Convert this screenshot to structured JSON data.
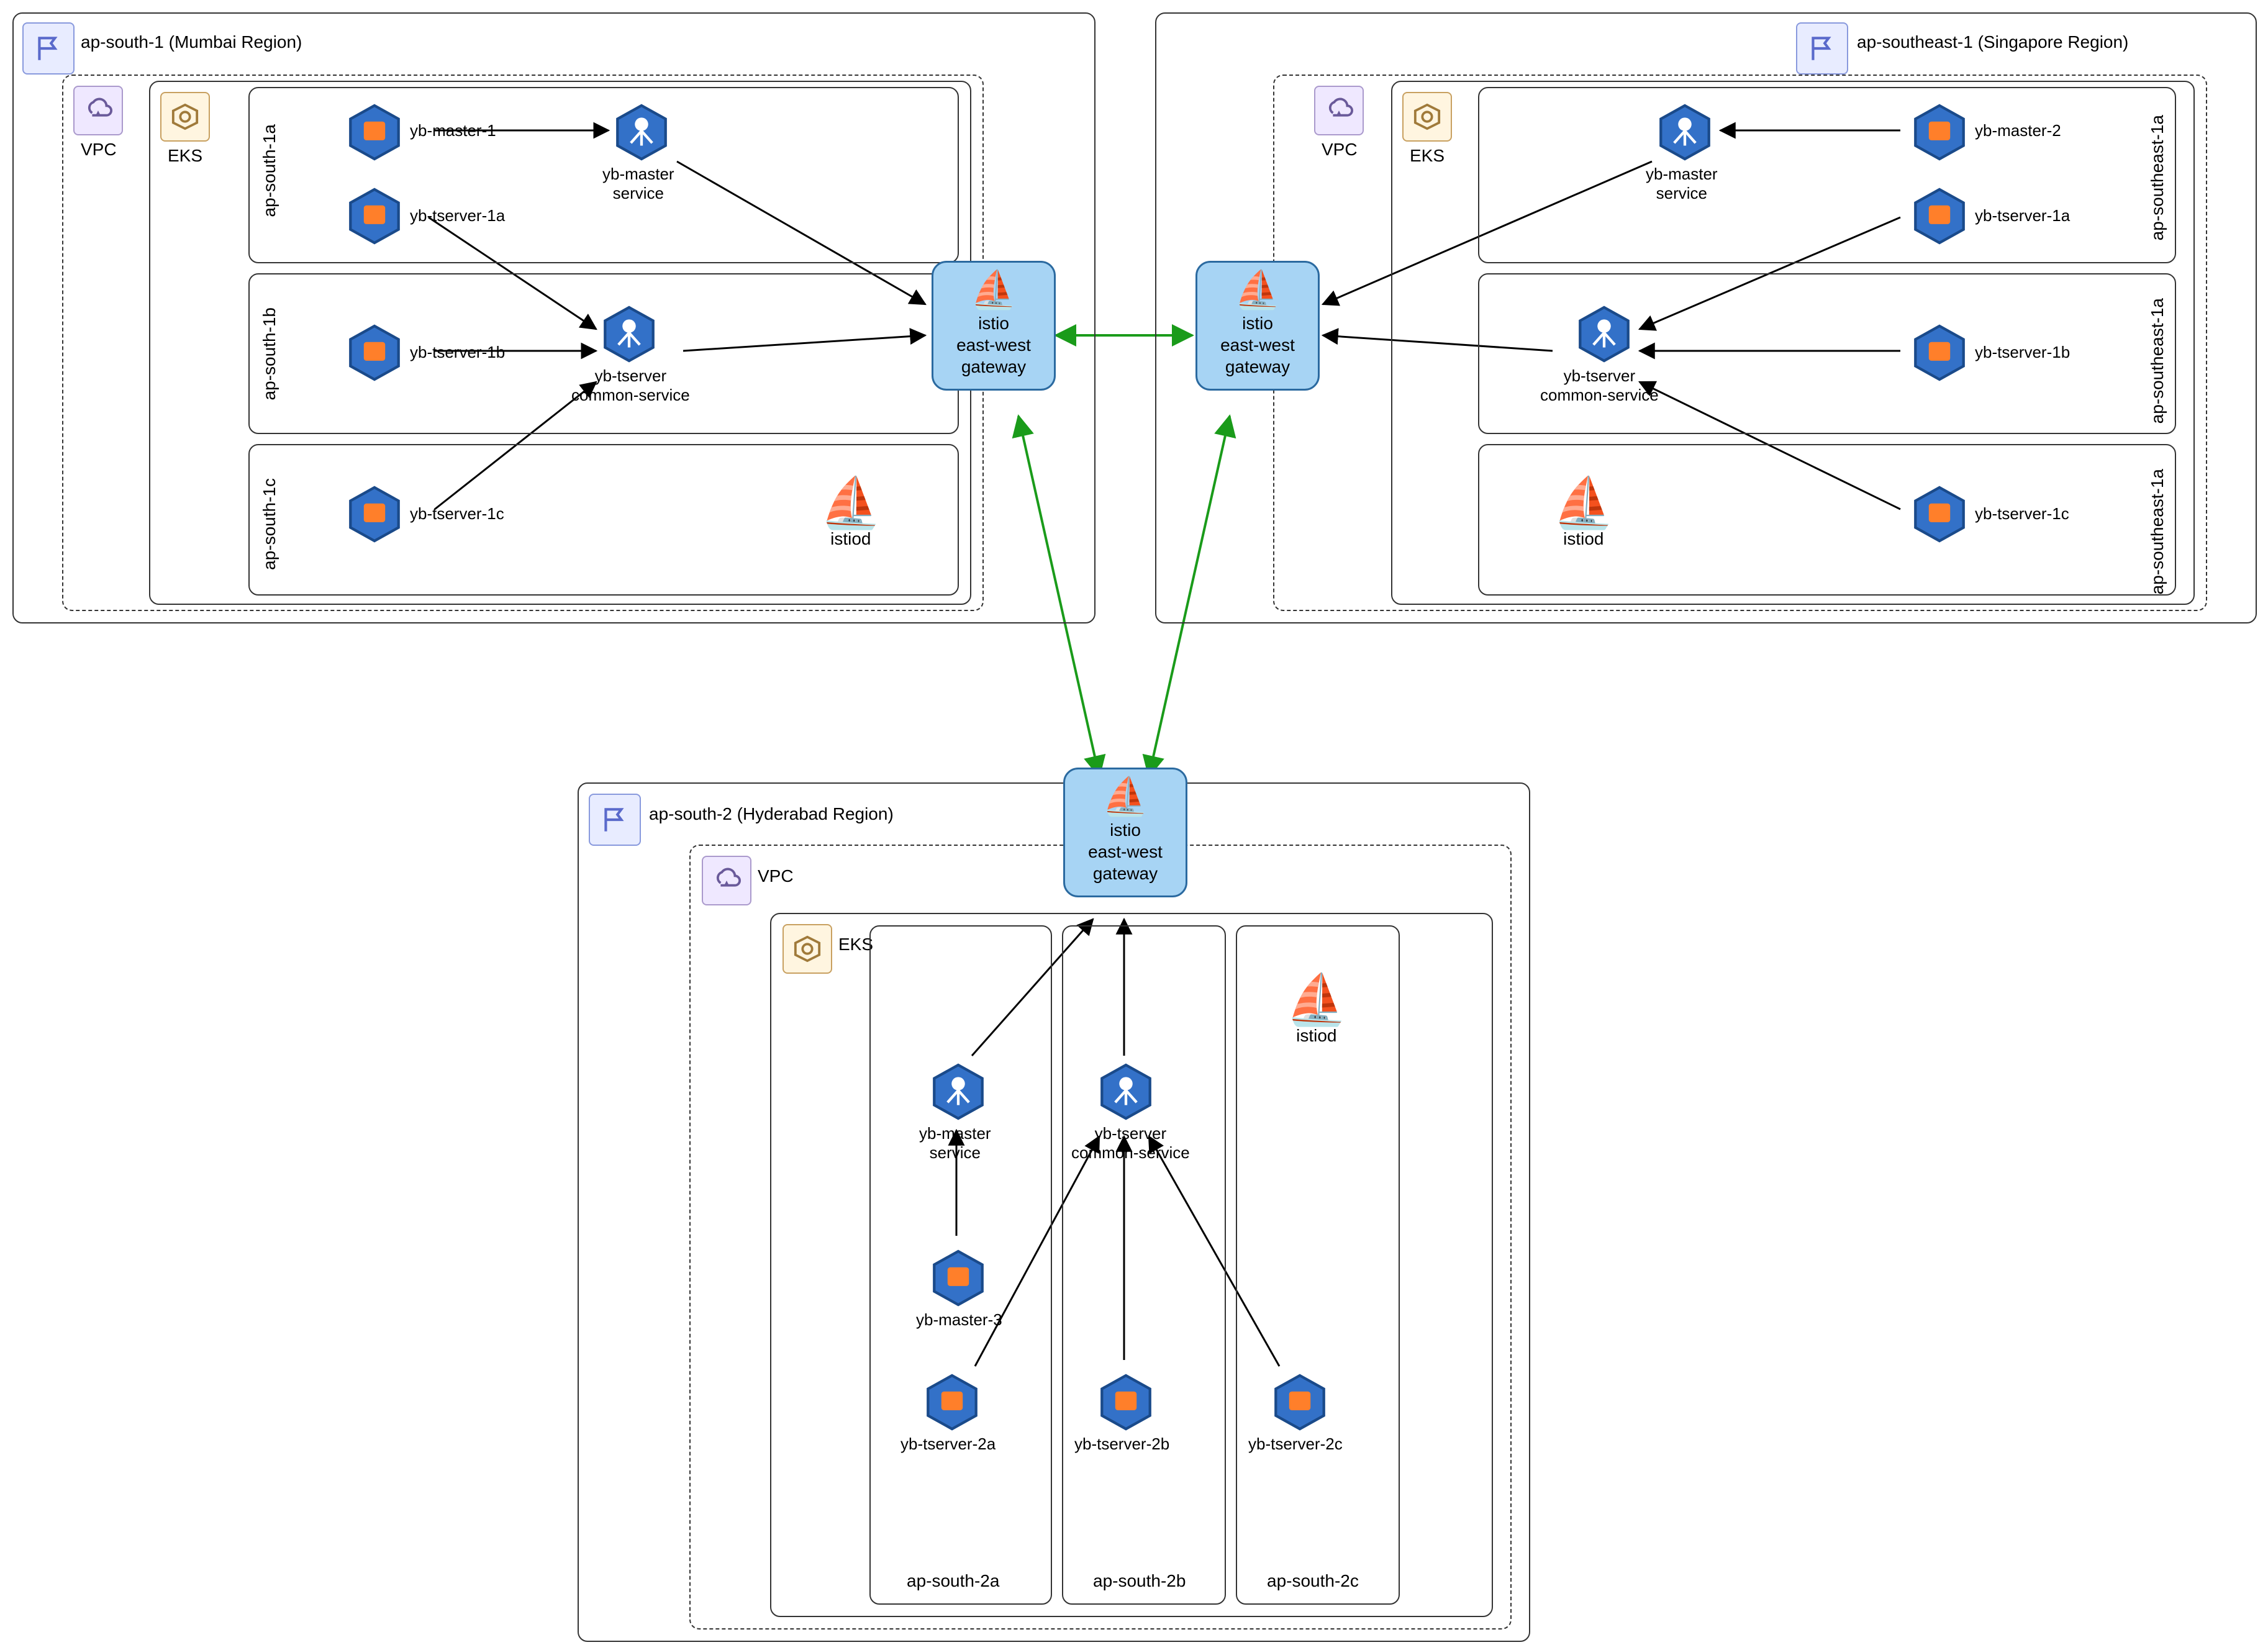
{
  "regions": {
    "mumbai": {
      "title": "ap-south-1 (Mumbai Region)",
      "vpc": "VPC",
      "eks": "EKS",
      "az_a": "ap-south-1a",
      "az_b": "ap-south-1b",
      "az_c": "ap-south-1c",
      "nodes": {
        "master1": "yb-master-1",
        "master_svc": "yb-master\nservice",
        "ts1a": "yb-tserver-1a",
        "ts1b": "yb-tserver-1b",
        "ts_common": "yb-tserver\ncommon-service",
        "ts1c": "yb-tserver-1c",
        "istiod": "istiod"
      },
      "gateway": "istio\neast-west\ngateway"
    },
    "singapore": {
      "title": "ap-southeast-1 (Singapore Region)",
      "vpc": "VPC",
      "eks": "EKS",
      "az_a": "ap-southeast-1a",
      "az_b": "ap-southeast-1a",
      "az_c": "ap-southeast-1a",
      "nodes": {
        "master2": "yb-master-2",
        "master_svc": "yb-master\nservice",
        "ts1a": "yb-tserver-1a",
        "ts1b": "yb-tserver-1b",
        "ts_common": "yb-tserver\ncommon-service",
        "ts1c": "yb-tserver-1c",
        "istiod": "istiod"
      },
      "gateway": "istio\neast-west\ngateway"
    },
    "hyderabad": {
      "title": "ap-south-2 (Hyderabad Region)",
      "vpc": "VPC",
      "eks": "EKS",
      "az_a": "ap-south-2a",
      "az_b": "ap-south-2b",
      "az_c": "ap-south-2c",
      "nodes": {
        "master3": "yb-master-3",
        "master_svc": "yb-master\nservice",
        "ts2a": "yb-tserver-2a",
        "ts2b": "yb-tserver-2b",
        "ts2c": "yb-tserver-2c",
        "ts_common": "yb-tserver\ncommon-service",
        "istiod": "istiod"
      },
      "gateway": "istio\neast-west\ngateway"
    }
  }
}
